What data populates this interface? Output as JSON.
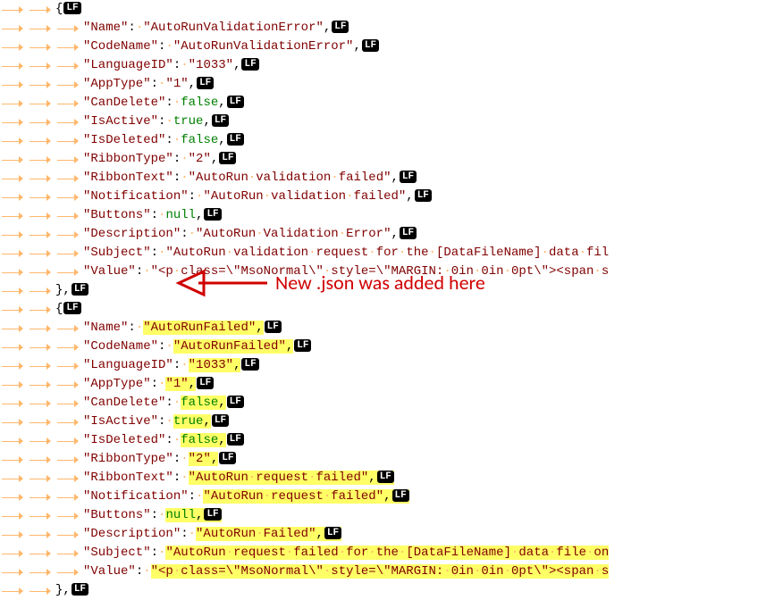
{
  "annotation": {
    "text": "New .json was added here"
  },
  "obj1": {
    "Name": "\"AutoRunValidationError\"",
    "CodeName": "\"AutoRunValidationError\"",
    "LanguageID": "\"1033\"",
    "AppType": "\"1\"",
    "CanDelete": "false",
    "IsActive": "true",
    "IsDeleted": "false",
    "RibbonType": "\"2\"",
    "RibbonText": "\"AutoRun validation failed\"",
    "Notification": "\"AutoRun validation failed\"",
    "Buttons": "null",
    "Description": "\"AutoRun Validation Error\"",
    "Subject": "\"AutoRun validation request for the [DataFileName] data fil",
    "Value": "\"<p class=\\\"MsoNormal\\\" style=\\\"MARGIN: 0in 0in 0pt\\\"><span s"
  },
  "obj2": {
    "Name": "\"AutoRunFailed\"",
    "CodeName": "\"AutoRunFailed\"",
    "LanguageID": "\"1033\"",
    "AppType": "\"1\"",
    "CanDelete": "false",
    "IsActive": "true",
    "IsDeleted": "false",
    "RibbonType": "\"2\"",
    "RibbonText": "\"AutoRun request failed\"",
    "Notification": "\"AutoRun request failed\"",
    "Buttons": "null",
    "Description": "\"AutoRun Failed\"",
    "Subject": "\"AutoRun request failed for the [DataFileName] data file on",
    "Value": "\"<p class=\\\"MsoNormal\\\" style=\\\"MARGIN: 0in 0in 0pt\\\"><span s"
  }
}
